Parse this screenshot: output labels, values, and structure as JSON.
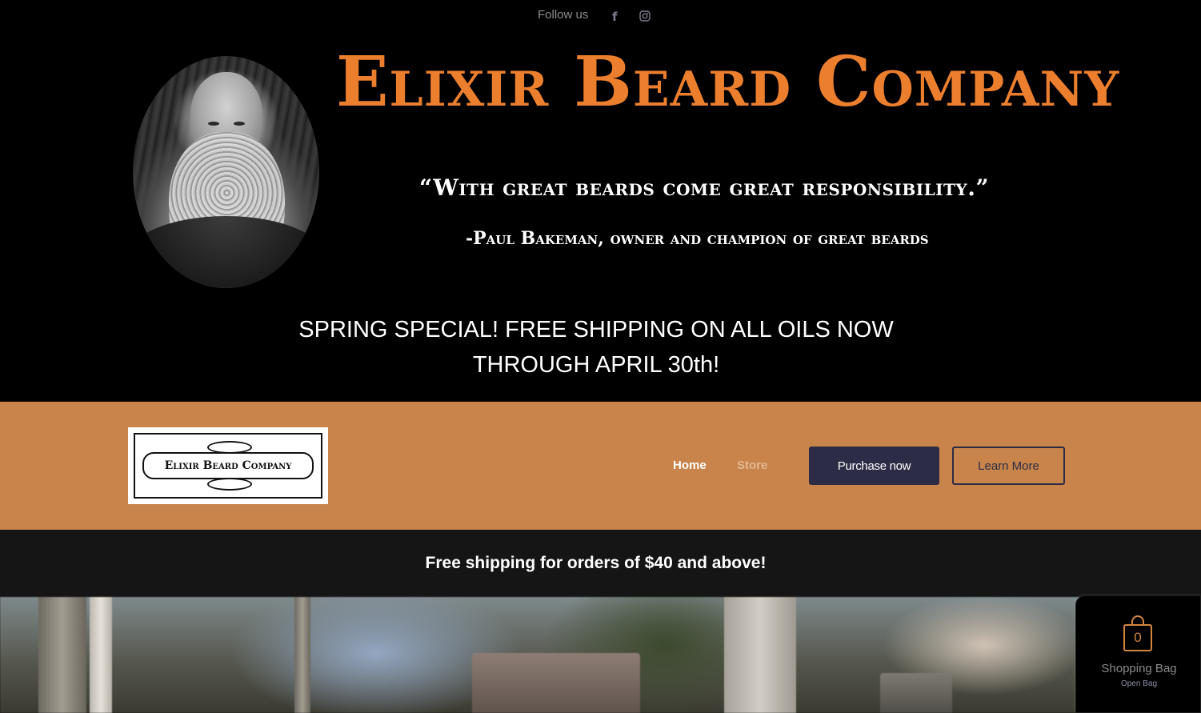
{
  "header": {
    "follow_label": "Follow us",
    "social": [
      {
        "icon": "facebook-icon",
        "glyph": "f"
      },
      {
        "icon": "instagram-icon"
      }
    ],
    "brand_title": "Elixir Beard Company",
    "quote": "“With great beards come great responsibility.”",
    "attribution": "-Paul Bakeman, owner and champion of great beards",
    "special_line1": "SPRING SPECIAL!  FREE SHIPPING  ON ALL OILS NOW",
    "special_line2": "THROUGH APRIL 30th!",
    "brand_color": "#ec7f2e"
  },
  "nav": {
    "logo_text": "Elixir Beard Company",
    "home": "Home",
    "store": "Store",
    "purchase": "Purchase now",
    "learn": "Learn More",
    "bar_color": "#c8844a",
    "button_color": "#2c2c46"
  },
  "promo": {
    "text": "Free shipping for orders of $40 and above!"
  },
  "cart": {
    "count": "0",
    "title": "Shopping Bag",
    "subtitle": "Open Bag",
    "accent": "#d3853f"
  }
}
